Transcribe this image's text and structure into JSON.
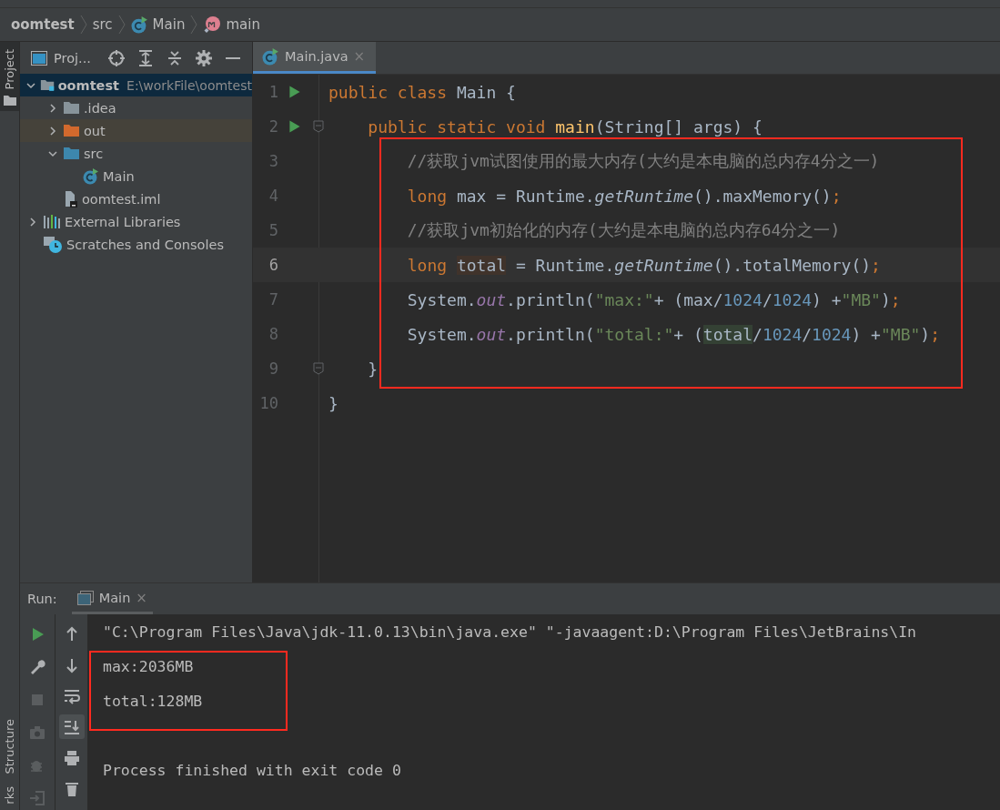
{
  "breadcrumbs": [
    {
      "label": "oomtest",
      "kind": "project"
    },
    {
      "label": "src",
      "kind": "folder"
    },
    {
      "label": "Main",
      "kind": "class"
    },
    {
      "label": "main",
      "kind": "method"
    }
  ],
  "side_tabs": {
    "top": [
      {
        "label": "Project",
        "selected": true
      }
    ],
    "bottom": [
      {
        "label": "Structure",
        "selected": false
      },
      {
        "label": "rks",
        "selected": false
      }
    ]
  },
  "project_panel": {
    "title": "Proj...",
    "tree": [
      {
        "label": "oomtest",
        "path": "E:\\workFile\\oomtest",
        "kind": "module",
        "expanded": true,
        "selected": true,
        "children": [
          {
            "label": ".idea",
            "kind": "folder",
            "expanded": false,
            "selected": false
          },
          {
            "label": "out",
            "kind": "excluded",
            "expanded": false,
            "selected": false
          },
          {
            "label": "src",
            "kind": "source",
            "expanded": true,
            "selected": false,
            "children": [
              {
                "label": "Main",
                "kind": "class",
                "selected": false
              }
            ]
          },
          {
            "label": "oomtest.iml",
            "kind": "file",
            "selected": false
          }
        ]
      },
      {
        "label": "External Libraries",
        "kind": "libraries",
        "expanded": false,
        "selected": false
      },
      {
        "label": "Scratches and Consoles",
        "kind": "scratches",
        "selected": false
      }
    ]
  },
  "editor": {
    "tabs": [
      {
        "label": "Main.java",
        "selected": true,
        "close": "×"
      }
    ],
    "lines": [
      {
        "number": "1",
        "run": true,
        "fold": false,
        "current": false,
        "framed": false,
        "tokens": [
          {
            "kind": "kw",
            "text": "public class "
          },
          {
            "kind": "plain",
            "text": "Main {"
          }
        ]
      },
      {
        "number": "2",
        "run": true,
        "fold": true,
        "current": false,
        "framed": false,
        "tokens": [
          {
            "kind": "kw",
            "text": "    public static void "
          },
          {
            "kind": "decl",
            "text": "main"
          },
          {
            "kind": "plain",
            "text": "(String[] args) {"
          }
        ]
      },
      {
        "number": "3",
        "run": false,
        "fold": false,
        "current": false,
        "framed": true,
        "tokens": [
          {
            "kind": "comment",
            "text": "        //获取jvm试图使用的最大内存(大约是本电脑的总内存4分之一)"
          }
        ]
      },
      {
        "number": "4",
        "run": false,
        "fold": false,
        "current": false,
        "framed": true,
        "tokens": [
          {
            "kind": "kw",
            "text": "        long "
          },
          {
            "kind": "plain",
            "text": "max = Runtime."
          },
          {
            "kind": "italic",
            "text": "getRuntime"
          },
          {
            "kind": "plain",
            "text": "().maxMemory()"
          },
          {
            "kind": "kw",
            "text": ";"
          }
        ]
      },
      {
        "number": "5",
        "run": false,
        "fold": false,
        "current": false,
        "framed": true,
        "tokens": [
          {
            "kind": "comment",
            "text": "        //获取jvm初始化的内存(大约是本电脑的总内存64分之一)"
          }
        ]
      },
      {
        "number": "6",
        "run": false,
        "fold": false,
        "current": true,
        "framed": true,
        "tokens": [
          {
            "kind": "kw",
            "text": "        long "
          },
          {
            "kind": "plain",
            "text": "total",
            "color": "#40332b"
          },
          {
            "kind": "plain",
            "text": " = Runtime."
          },
          {
            "kind": "italic",
            "text": "getRuntime"
          },
          {
            "kind": "plain",
            "text": "().totalMemory()"
          },
          {
            "kind": "kw",
            "text": ";"
          }
        ]
      },
      {
        "number": "7",
        "run": false,
        "fold": false,
        "current": false,
        "framed": true,
        "tokens": [
          {
            "kind": "plain",
            "text": "        System."
          },
          {
            "kind": "field",
            "text": "out"
          },
          {
            "kind": "plain",
            "text": ".println("
          },
          {
            "kind": "str",
            "text": "\"max:\""
          },
          {
            "kind": "plain",
            "text": "+ (max/"
          },
          {
            "kind": "num",
            "text": "1024"
          },
          {
            "kind": "plain",
            "text": "/"
          },
          {
            "kind": "num",
            "text": "1024"
          },
          {
            "kind": "plain",
            "text": ") +"
          },
          {
            "kind": "str",
            "text": "\"MB\""
          },
          {
            "kind": "plain",
            "text": ")"
          },
          {
            "kind": "kw",
            "text": ";"
          }
        ]
      },
      {
        "number": "8",
        "run": false,
        "fold": false,
        "current": false,
        "framed": true,
        "tokens": [
          {
            "kind": "plain",
            "text": "        System."
          },
          {
            "kind": "field",
            "text": "out"
          },
          {
            "kind": "plain",
            "text": ".println("
          },
          {
            "kind": "str",
            "text": "\"total:\""
          },
          {
            "kind": "plain",
            "text": "+ ("
          },
          {
            "kind": "plain",
            "text": "total",
            "color": "#344134"
          },
          {
            "kind": "plain",
            "text": "/"
          },
          {
            "kind": "num",
            "text": "1024"
          },
          {
            "kind": "plain",
            "text": "/"
          },
          {
            "kind": "num",
            "text": "1024"
          },
          {
            "kind": "plain",
            "text": ") +"
          },
          {
            "kind": "str",
            "text": "\"MB\""
          },
          {
            "kind": "plain",
            "text": ")"
          },
          {
            "kind": "kw",
            "text": ";"
          }
        ]
      },
      {
        "number": "9",
        "run": false,
        "fold": true,
        "current": false,
        "framed": true,
        "tokens": [
          {
            "kind": "plain",
            "text": "    }"
          }
        ]
      },
      {
        "number": "10",
        "run": false,
        "fold": false,
        "current": false,
        "framed": false,
        "tokens": [
          {
            "kind": "plain",
            "text": "}"
          }
        ]
      }
    ]
  },
  "run_panel": {
    "label": "Run:",
    "tabs": [
      {
        "label": "Main",
        "selected": true,
        "close": "×"
      }
    ],
    "tools": [
      {
        "kind": "run",
        "disabled": false
      },
      {
        "kind": "wrench",
        "disabled": false
      },
      {
        "kind": "stop",
        "disabled": true
      },
      {
        "kind": "camera",
        "disabled": true
      },
      {
        "kind": "bug",
        "disabled": true
      },
      {
        "kind": "exit",
        "disabled": true
      }
    ],
    "actions": [
      {
        "kind": "up",
        "on": false
      },
      {
        "kind": "down",
        "on": false
      },
      {
        "kind": "wrap",
        "on": false
      },
      {
        "kind": "scroll-end",
        "on": true
      },
      {
        "kind": "print",
        "on": false
      },
      {
        "kind": "trash",
        "on": false
      }
    ],
    "console": [
      {
        "kind": "command",
        "text": "\"C:\\Program Files\\Java\\jdk-11.0.13\\bin\\java.exe\" \"-javaagent:D:\\Program Files\\JetBrains\\In",
        "framed": false
      },
      {
        "kind": "output",
        "text": "max:2036MB",
        "framed": true
      },
      {
        "kind": "output",
        "text": "total:128MB",
        "framed": true
      },
      {
        "kind": "exit",
        "text": "Process finished with exit code 0",
        "framed": false
      }
    ]
  }
}
